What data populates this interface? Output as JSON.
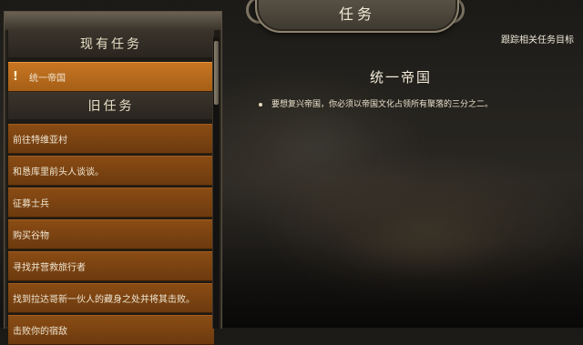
{
  "header": {
    "title": "任务",
    "track_label": "跟踪相关任务目标"
  },
  "quest_log": {
    "current_section": "现有任务",
    "current_quests": [
      {
        "label": "统一帝国",
        "marker": "!"
      }
    ],
    "old_section": "旧任务",
    "old_quests": [
      "前往特维亚村",
      "和恳库里前头人谈谈。",
      "征募士兵",
      "购买谷物",
      "寻找并营救旅行者",
      "找到拉达哥新一伙人的藏身之处并将其击败。",
      "击败你的宿敌"
    ]
  },
  "quest_detail": {
    "title": "统一帝国",
    "description": "要想复兴帝国，你必须以帝国文化占领所有聚落的三分之二。"
  }
}
